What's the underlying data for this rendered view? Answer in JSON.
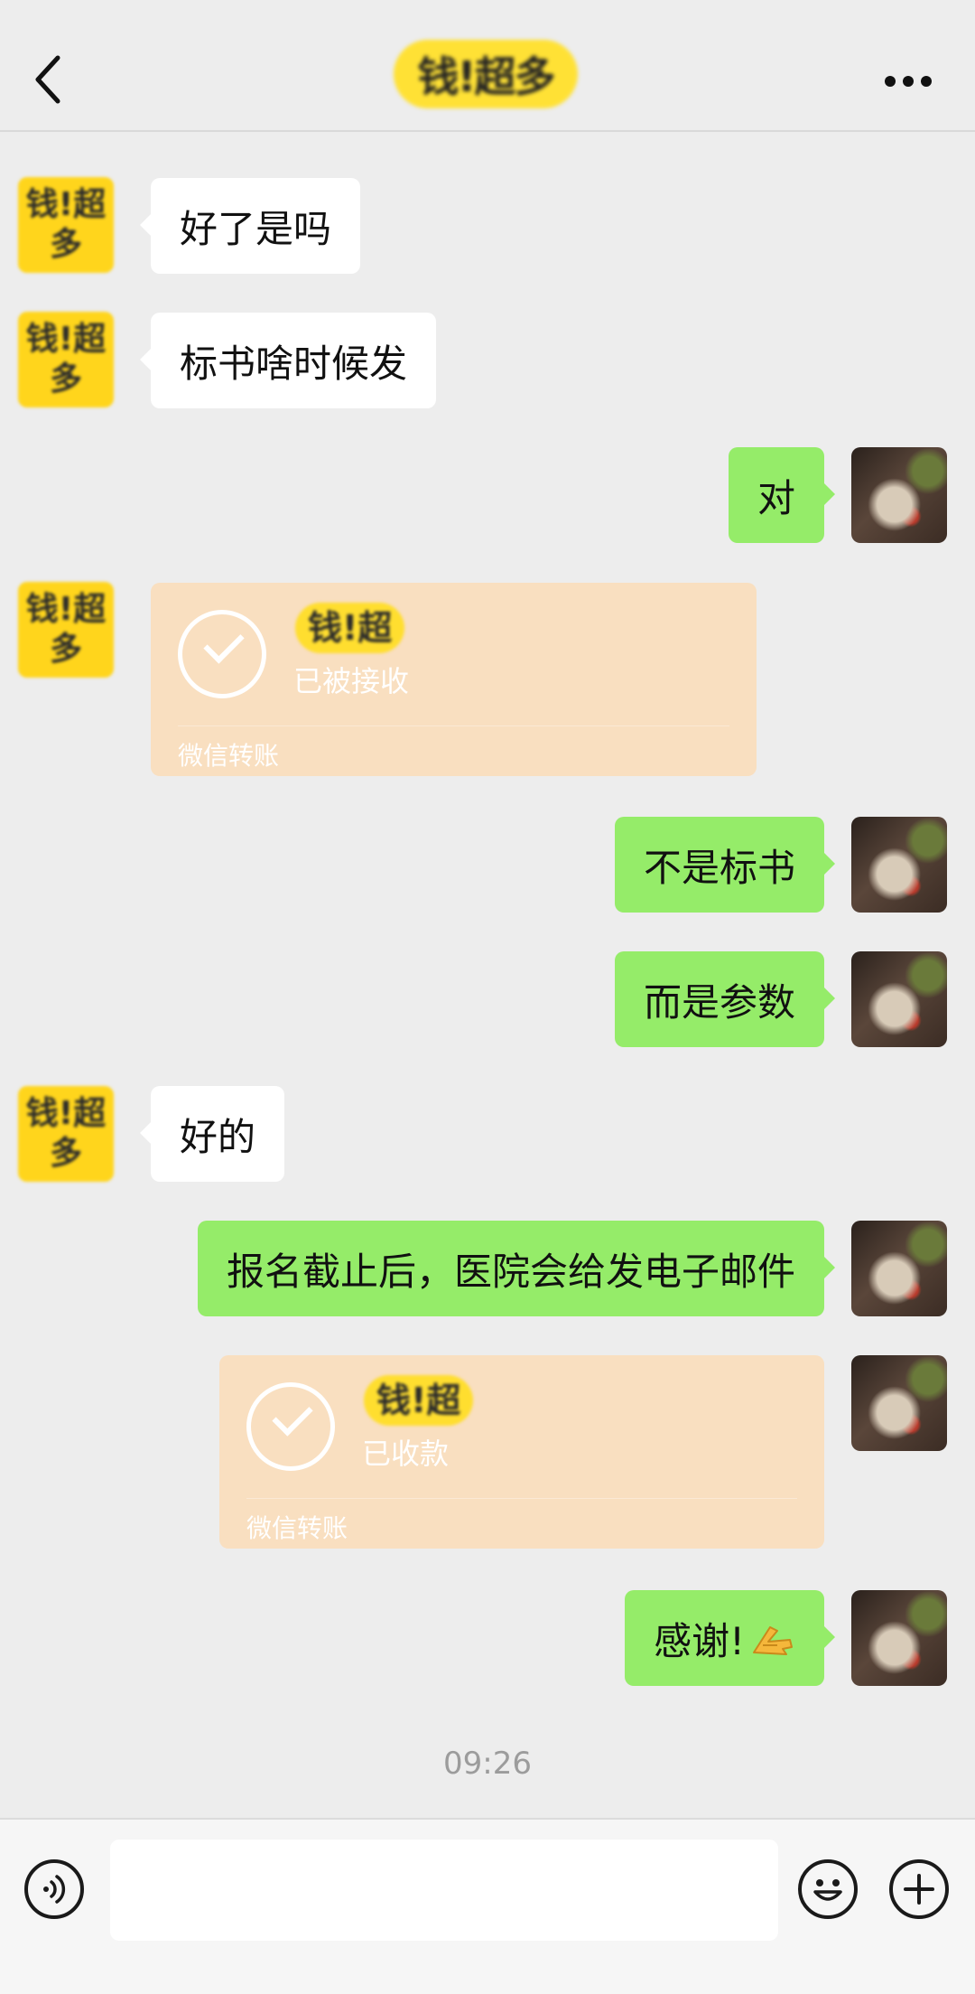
{
  "header": {
    "title": "钱!超多",
    "back_icon": "chevron-left-icon",
    "more_icon": "more-dots-icon"
  },
  "contact_avatar_text": "钱!超多",
  "messages": [
    {
      "side": "left",
      "type": "text",
      "text": "好了是吗"
    },
    {
      "side": "left",
      "type": "text",
      "text": "标书啥时候发"
    },
    {
      "side": "right",
      "type": "text",
      "text": "对"
    },
    {
      "side": "left",
      "type": "transfer",
      "amount": "钱!超",
      "status": "已被接收",
      "footer": "微信转账"
    },
    {
      "side": "right",
      "type": "text",
      "text": "不是标书"
    },
    {
      "side": "right",
      "type": "text",
      "text": "而是参数"
    },
    {
      "side": "left",
      "type": "text",
      "text": "好的"
    },
    {
      "side": "right",
      "type": "text",
      "text": "报名截止后，医院会给发电子邮件"
    },
    {
      "side": "right",
      "type": "transfer",
      "amount": "钱!超",
      "status": "已收款",
      "footer": "微信转账"
    },
    {
      "side": "right",
      "type": "text",
      "text": "感谢!",
      "emoji": "ok-hand-emoji"
    }
  ],
  "timestamp": "09:26",
  "input_bar": {
    "voice_icon": "voice-icon",
    "emoji_icon": "emoji-icon",
    "plus_icon": "plus-icon",
    "value": ""
  },
  "colors": {
    "background": "#ededed",
    "my_bubble": "#95ec69",
    "their_bubble": "#ffffff",
    "transfer_card": "#f9dfc0"
  }
}
